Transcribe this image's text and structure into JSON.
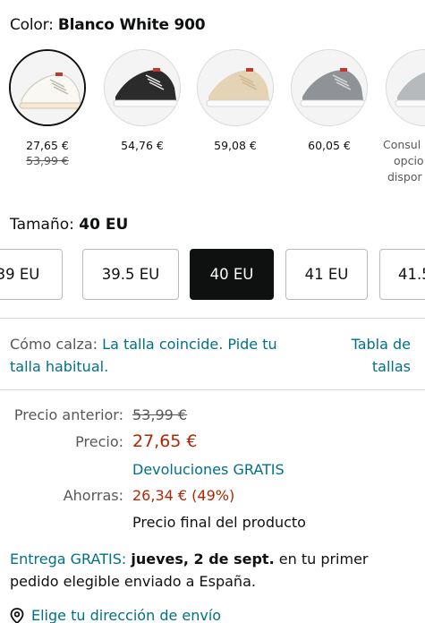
{
  "color": {
    "label": "Color:",
    "value": "Blanco White 900"
  },
  "swatches": [
    {
      "price": "27,65 €",
      "old_price": "53,99 €",
      "name": "white-shoe",
      "color": "#f7f4ee"
    },
    {
      "price": "54,76 €",
      "old_price": "",
      "name": "black-shoe",
      "color": "#2a2a2a"
    },
    {
      "price": "59,08 €",
      "old_price": "",
      "name": "beige-shoe",
      "color": "#e2d2b5"
    },
    {
      "price": "60,05 €",
      "old_price": "",
      "name": "grey-shoe",
      "color": "#8f9398"
    },
    {
      "consult_l1": "Consul",
      "consult_l2": "opcio",
      "consult_l3": "dispor",
      "name": "light-grey-shoe",
      "color": "#b7babd"
    }
  ],
  "size": {
    "label": "Tamaño:",
    "value": "40 EU",
    "options": [
      "39 EU",
      "39.5 EU",
      "40 EU",
      "41 EU",
      "41.5"
    ]
  },
  "fit": {
    "label": "Cómo calza:",
    "link": "La talla coincide. Pide tu talla habitual.",
    "chart_l1": "Tabla de",
    "chart_l2": "tallas"
  },
  "pricing": {
    "prev_label": "Precio anterior:",
    "prev_value": "53,99 €",
    "price_label": "Precio:",
    "price_value": "27,65 €",
    "returns": "Devoluciones GRATIS",
    "save_label": "Ahorras:",
    "save_value": "26,34 € (49%)",
    "final": "Precio final del producto"
  },
  "delivery": {
    "free": "Entrega GRATIS:",
    "date": "jueves, 2 de sept.",
    "rest": "en tu primer pedido elegible enviado a España."
  },
  "address": {
    "link": "Elige tu dirección de envío"
  }
}
